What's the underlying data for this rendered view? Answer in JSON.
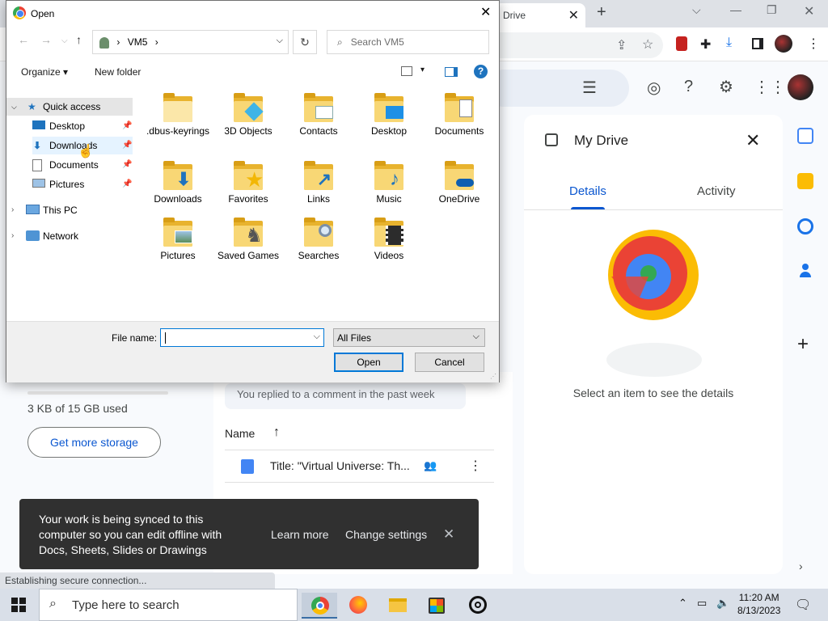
{
  "browser": {
    "tab_title": "Drive",
    "tab_close": "✕",
    "new_tab": "+"
  },
  "drive": {
    "details_panel": {
      "title": "My Drive",
      "tabs": [
        "Details",
        "Activity"
      ],
      "active_tab": "Details",
      "empty_message": "Select an item to see the details"
    },
    "activity_chip": "You replied to a comment in the past week",
    "storage_text": "3 KB of 15 GB used",
    "get_storage_label": "Get more storage",
    "list_header": "Name",
    "files": [
      {
        "title": "Title: \"Virtual Universe: Th..."
      }
    ],
    "snackbar": {
      "message": "Your work is being synced to this computer so you can edit offline with Docs, Sheets, Slides or Drawings",
      "learn_more": "Learn more",
      "change_settings": "Change settings"
    },
    "status_bar": "Establishing secure connection..."
  },
  "dialog": {
    "title": "Open",
    "address": {
      "path_segment": "VM5",
      "separator": "›"
    },
    "search_placeholder": "Search VM5",
    "toolbar": {
      "organize": "Organize ▾",
      "new_folder": "New folder",
      "help": "?"
    },
    "nav": {
      "quick_access": "Quick access",
      "items": [
        "Desktop",
        "Downloads",
        "Documents",
        "Pictures"
      ],
      "this_pc": "This PC",
      "network": "Network"
    },
    "folders": [
      {
        "name": ".dbus-keyrings",
        "icon": "plain-folder-icon"
      },
      {
        "name": "3D Objects",
        "icon": "3d-objects-folder-icon"
      },
      {
        "name": "Contacts",
        "icon": "contacts-folder-icon"
      },
      {
        "name": "Desktop",
        "icon": "desktop-folder-icon"
      },
      {
        "name": "Documents",
        "icon": "documents-folder-icon"
      },
      {
        "name": "Downloads",
        "icon": "downloads-folder-icon"
      },
      {
        "name": "Favorites",
        "icon": "favorites-folder-icon"
      },
      {
        "name": "Links",
        "icon": "links-folder-icon"
      },
      {
        "name": "Music",
        "icon": "music-folder-icon"
      },
      {
        "name": "OneDrive",
        "icon": "onedrive-folder-icon"
      },
      {
        "name": "Pictures",
        "icon": "pictures-folder-icon"
      },
      {
        "name": "Saved Games",
        "icon": "saved-games-folder-icon"
      },
      {
        "name": "Searches",
        "icon": "searches-folder-icon"
      },
      {
        "name": "Videos",
        "icon": "videos-folder-icon"
      }
    ],
    "file_name_label": "File name:",
    "file_name_value": "",
    "file_type_filter": "All Files",
    "open_button": "Open",
    "cancel_button": "Cancel"
  },
  "taskbar": {
    "search_placeholder": "Type here to search",
    "time": "11:20 AM",
    "date": "8/13/2023"
  },
  "colors": {
    "accent_blue": "#0b57d0",
    "folder_yellow": "#f8d775",
    "dialog_selection": "#0078d7"
  }
}
